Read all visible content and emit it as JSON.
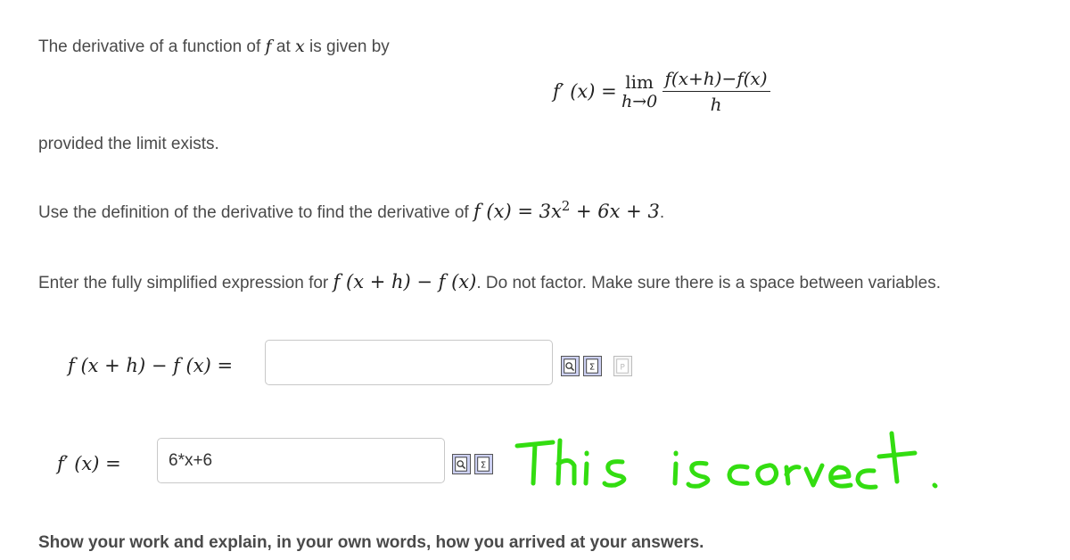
{
  "intro": {
    "line1": "The derivative of a function of f at x is given by",
    "line1_pre": "The derivative of a function of",
    "line1_f": "f",
    "line1_mid": "at",
    "line1_x": "x",
    "line1_post": "is given by",
    "provided": "provided the limit exists."
  },
  "formula": {
    "lhs": "f′ (x) =",
    "lim_word": "lim",
    "lim_sub": "h→0",
    "numerator": "f(x+h)−f(x)",
    "denominator": "h"
  },
  "task": {
    "pre": "Use the definition of the derivative to find the derivative of",
    "expr": "f (x) = 3x",
    "exp": "2",
    "expr_tail": "+ 6x + 3",
    "end": "."
  },
  "instruction": {
    "pre": "Enter the fully simplified expression for",
    "expr": "f (x + h) − f (x)",
    "post": ". Do not factor. Make sure there is a space between variables."
  },
  "answer1": {
    "label": "f (x + h) − f (x) =",
    "value": ""
  },
  "answer2": {
    "label": "f′ (x) =",
    "value": "6*x+6"
  },
  "annotation": {
    "text": "This is correct.",
    "color": "#33dd11"
  },
  "footer": {
    "text": "Show your work and explain, in your own words, how you arrived at your answers."
  },
  "icons": [
    "preview-icon",
    "equation-editor-icon",
    "pdf-icon"
  ]
}
